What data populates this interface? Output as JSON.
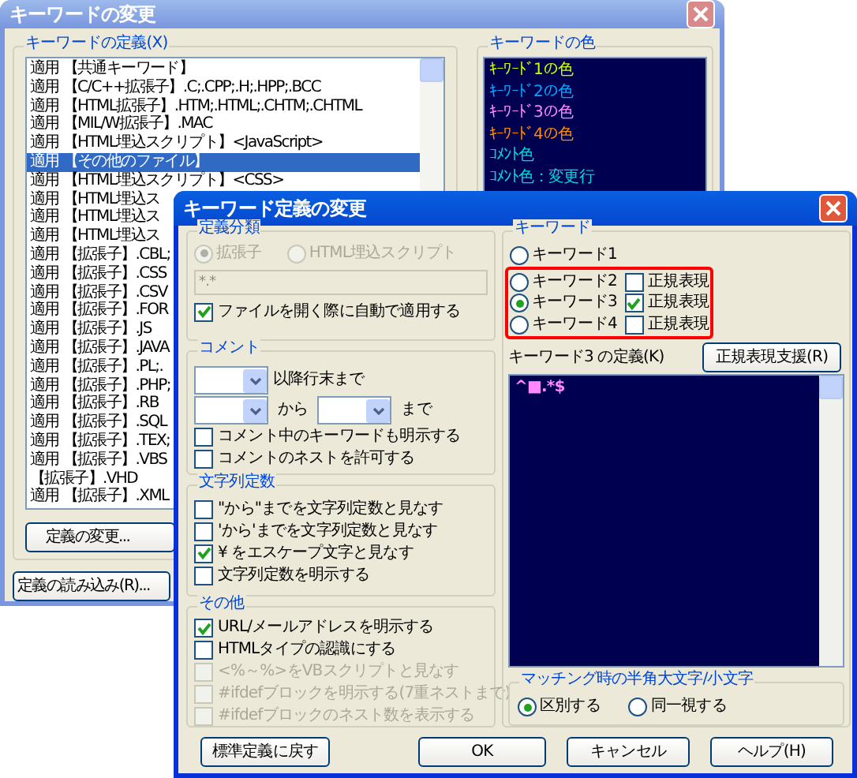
{
  "back_window": {
    "title": "キーワードの変更",
    "definition_group": {
      "label": "キーワードの定義(X)",
      "items": [
        {
          "prefix": "適用",
          "text": "【共通キーワード】",
          "selected": false
        },
        {
          "prefix": "適用",
          "text": "【C/C++拡張子】.C;.CPP;.H;.HPP;.BCC",
          "selected": false
        },
        {
          "prefix": "適用",
          "text": "【HTML拡張子】.HTM;.HTML;.CHTM;.CHTML",
          "selected": false
        },
        {
          "prefix": "適用",
          "text": "【MIL/W拡張子】.MAC",
          "selected": false
        },
        {
          "prefix": "適用",
          "text": "【HTML埋込スクリプト】<JavaScript>",
          "selected": false
        },
        {
          "prefix": "適用",
          "text": "【その他のファイル】",
          "selected": true
        },
        {
          "prefix": "適用",
          "text": "【HTML埋込スクリプト】<CSS>",
          "selected": false
        },
        {
          "prefix": "適用",
          "text": "【HTML埋込ス",
          "selected": false
        },
        {
          "prefix": "適用",
          "text": "【HTML埋込ス",
          "selected": false
        },
        {
          "prefix": "適用",
          "text": "【HTML埋込ス",
          "selected": false
        },
        {
          "prefix": "適用",
          "text": "【拡張子】.CBL;",
          "selected": false
        },
        {
          "prefix": "適用",
          "text": "【拡張子】.CSS",
          "selected": false
        },
        {
          "prefix": "適用",
          "text": "【拡張子】.CSV",
          "selected": false
        },
        {
          "prefix": "適用",
          "text": "【拡張子】.FOR",
          "selected": false
        },
        {
          "prefix": "適用",
          "text": "【拡張子】.JS",
          "selected": false
        },
        {
          "prefix": "適用",
          "text": "【拡張子】.JAVA",
          "selected": false
        },
        {
          "prefix": "適用",
          "text": "【拡張子】.PL;.",
          "selected": false
        },
        {
          "prefix": "適用",
          "text": "【拡張子】.PHP;",
          "selected": false
        },
        {
          "prefix": "適用",
          "text": "【拡張子】.RB",
          "selected": false
        },
        {
          "prefix": "適用",
          "text": "【拡張子】.SQL",
          "selected": false
        },
        {
          "prefix": "適用",
          "text": "【拡張子】.TEX;",
          "selected": false
        },
        {
          "prefix": "適用",
          "text": "【拡張子】.VBS",
          "selected": false
        },
        {
          "text": "【拡張子】.VHD",
          "selected": false
        },
        {
          "prefix": "適用",
          "text": "【拡張子】.XML",
          "selected": false
        }
      ],
      "button": "定義の変更..."
    },
    "load_button": "定義の読み込み(R)...",
    "color_group": {
      "label": "キーワードの色",
      "entries": [
        {
          "text": "ｷｰﾜｰﾄﾞ1の色",
          "color": "#c8ff00"
        },
        {
          "text": "ｷｰﾜｰﾄﾞ2の色",
          "color": "#00a8ff"
        },
        {
          "text": "ｷｰﾜｰﾄﾞ3の色",
          "color": "#ff88ff"
        },
        {
          "text": "ｷｰﾜｰﾄﾞ4の色",
          "color": "#ff8c00"
        },
        {
          "text": "ｺﾒﾝﾄ色",
          "color": "#00d8d8"
        },
        {
          "text": "ｺﾒﾝﾄ色：変更行",
          "color": "#00d8d8"
        }
      ]
    }
  },
  "dialog": {
    "title": "キーワード定義の変更",
    "category": {
      "label": "定義分類",
      "radios": [
        {
          "label": "拡張子",
          "selected": true,
          "disabled": true
        },
        {
          "label": "HTML埋込スクリプト",
          "selected": false,
          "disabled": true
        }
      ],
      "pattern": {
        "value": "*.*",
        "disabled": true
      },
      "checkboxes": [
        {
          "label": "ファイルを開く際に自動で適用する",
          "checked": true,
          "disabled": false
        }
      ]
    },
    "comment": {
      "label": "コメント",
      "line_suffix": "以降行末まで",
      "from": "から",
      "to": "まで",
      "checkboxes": [
        {
          "label": "コメント中のキーワードも明示する",
          "checked": false,
          "disabled": false
        },
        {
          "label": "コメントのネストを許可する",
          "checked": false,
          "disabled": false
        }
      ]
    },
    "string": {
      "label": "文字列定数",
      "checkboxes": [
        {
          "label": "\"から\"までを文字列定数と見なす",
          "checked": false,
          "disabled": false
        },
        {
          "label": "'から'までを文字列定数と見なす",
          "checked": false,
          "disabled": false
        },
        {
          "label": "¥ をエスケープ文字と見なす",
          "checked": true,
          "disabled": false
        },
        {
          "label": "文字列定数を明示する",
          "checked": false,
          "disabled": false
        }
      ]
    },
    "other": {
      "label": "その他",
      "checkboxes": [
        {
          "label": "URL/メールアドレスを明示する",
          "checked": true,
          "disabled": false
        },
        {
          "label": "HTMLタイプの認識にする",
          "checked": false,
          "disabled": false
        },
        {
          "label": "<%～%>をVBスクリプトと見なす",
          "checked": false,
          "disabled": true
        },
        {
          "label": "#ifdefブロックを明示する(7重ネストまで)",
          "checked": false,
          "disabled": true
        },
        {
          "label": "#ifdefブロックのネスト数を表示する",
          "checked": false,
          "disabled": true
        }
      ]
    },
    "keyword": {
      "label": "キーワード",
      "rows": [
        {
          "label": "キーワード1",
          "selected": false
        },
        {
          "label": "キーワード2",
          "selected": false,
          "regex": {
            "label": "正規表現",
            "checked": false
          }
        },
        {
          "label": "キーワード3",
          "selected": true,
          "regex": {
            "label": "正規表現",
            "checked": true
          }
        },
        {
          "label": "キーワード4",
          "selected": false,
          "regex": {
            "label": "正規表現",
            "checked": false
          }
        }
      ],
      "definition_label": "キーワード3 の定義(K)",
      "regex_button": "正規表現支援(R)",
      "definition": "^■.*$",
      "case": {
        "label": "マッチング時の半角大文字/小文字",
        "radios": [
          {
            "label": "区別する",
            "selected": true
          },
          {
            "label": "同一視する",
            "selected": false
          }
        ]
      }
    },
    "buttons": [
      "標準定義に戻す",
      "OK",
      "キャンセル",
      "ヘルプ(H)"
    ]
  }
}
